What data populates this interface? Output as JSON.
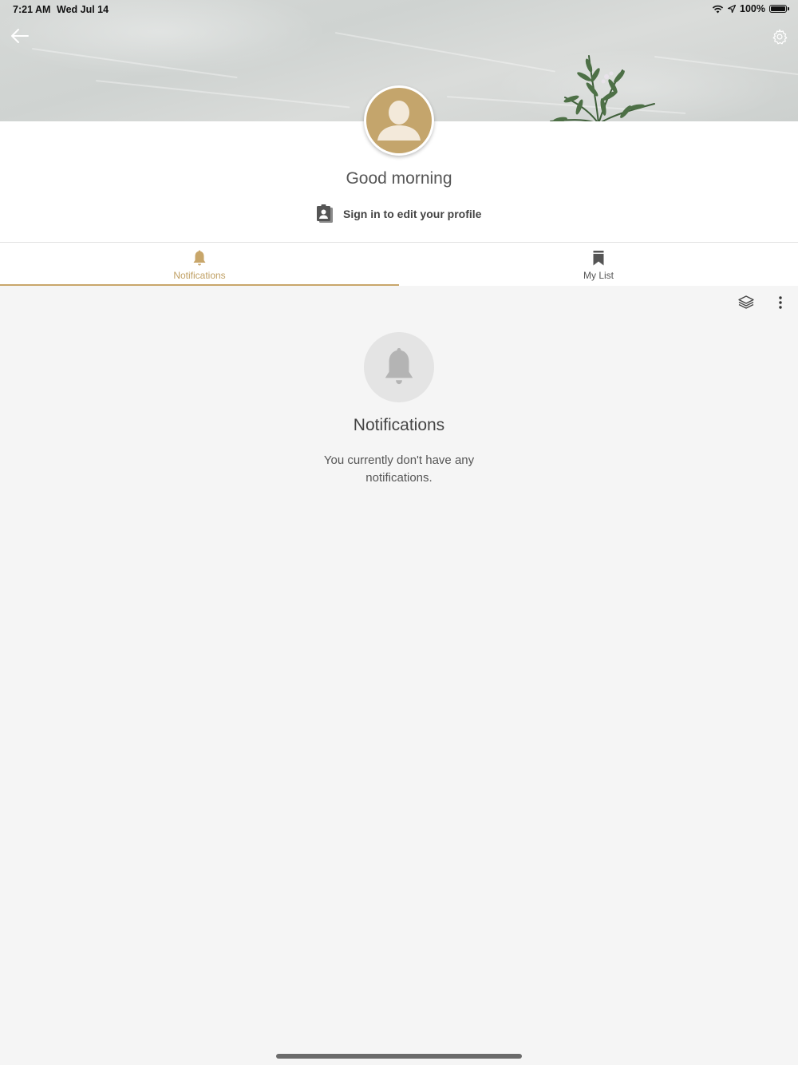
{
  "status_bar": {
    "time": "7:21 AM",
    "date": "Wed Jul 14",
    "battery": "100%"
  },
  "header": {
    "back_icon": "arrow-left-icon",
    "settings_icon": "gear-icon"
  },
  "profile": {
    "greeting": "Good morning",
    "signin_label": "Sign in to edit your profile",
    "signin_icon": "profile-badge-icon"
  },
  "tabs": [
    {
      "label": "Notifications",
      "icon": "bell-icon",
      "active": true
    },
    {
      "label": "My List",
      "icon": "bookmark-icon",
      "active": false
    }
  ],
  "toolbar": {
    "layers_icon": "layers-icon",
    "more_icon": "more-vertical-icon"
  },
  "empty_state": {
    "icon": "bell-icon",
    "title": "Notifications",
    "message": "You currently don't have any notifications."
  },
  "colors": {
    "accent": "#c8a66a",
    "avatar": "#c4a56c",
    "background": "#f5f5f5"
  }
}
